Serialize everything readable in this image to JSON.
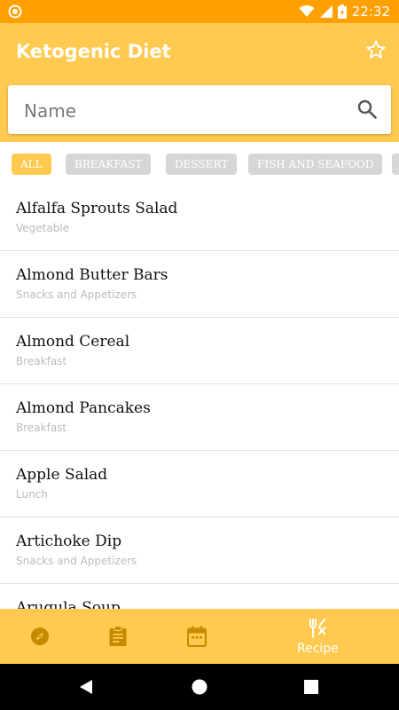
{
  "status_bar": {
    "time": "22:32"
  },
  "app_bar": {
    "title": "Ketogenic Diet"
  },
  "search": {
    "placeholder": "Name",
    "value": ""
  },
  "filters": [
    "ALL",
    "BREAKFAST",
    "DESSERT",
    "FISH AND SEAFOOD"
  ],
  "selected_filter": "ALL",
  "recipes": [
    {
      "name": "Alfalfa Sprouts Salad",
      "category": "Vegetable"
    },
    {
      "name": "Almond Butter Bars",
      "category": "Snacks and Appetizers"
    },
    {
      "name": "Almond Cereal",
      "category": "Breakfast"
    },
    {
      "name": "Almond Pancakes",
      "category": "Breakfast"
    },
    {
      "name": "Apple Salad",
      "category": "Lunch"
    },
    {
      "name": "Artichoke Dip",
      "category": "Snacks and Appetizers"
    },
    {
      "name": "Arugula Soup",
      "category": ""
    }
  ],
  "bottom_nav": {
    "active_label": "Recipe"
  },
  "icons": {
    "status_left": "circle-notification-icon",
    "favorite": "star-outline-icon",
    "search": "search-icon",
    "nav": [
      "compass-icon",
      "clipboard-icon",
      "calendar-icon",
      "fork-knife-icon"
    ],
    "system": [
      "back-icon",
      "home-icon",
      "recents-icon"
    ]
  },
  "colors": {
    "status_bar": "#FFA000",
    "primary": "#FFCA4F",
    "chip_inactive": "#D6D6D6",
    "nav_icon_inactive": "#C58A00",
    "divider": "#E2E2E2"
  }
}
